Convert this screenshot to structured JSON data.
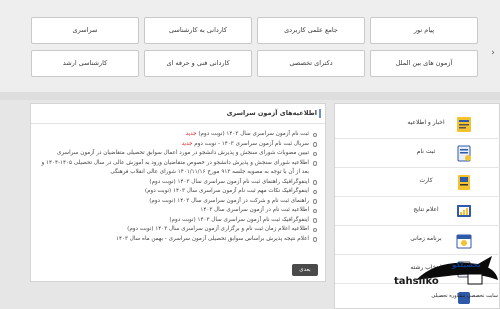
{
  "nav": {
    "row1": [
      "پیام نور",
      "جامع علمی کاربردی",
      "کاردانی به کارشناسی",
      "سراسری"
    ],
    "row2": [
      "آزمون های بین الملل",
      "دکترای تخصصی",
      "کاردانی فنی و حرفه ای",
      "کارشناسی ارشد"
    ],
    "pager": "›"
  },
  "news": {
    "title": "اطلاعیه‌های آزمون سراسری",
    "items": [
      {
        "text": "ثبت نام آزمون سراسری سال ۱۴۰۳ (نوبت دوم)",
        "tag": "جدید"
      },
      {
        "text": "سریال ثبت نام آزمون سراسری ۱۴۰۳ - نوبت دوم",
        "tag": "جدید"
      },
      {
        "text": "تبیین مصوبات شورای سنجش و پذیرش دانشجو در مورد اعمال سوابق تحصیلی متقاضیان در آزمون سراسری",
        "tag": ""
      },
      {
        "text": "اطلاعیه شورای سنجش و پذیرش دانشجو در خصوص متقاضیان ورود به آموزش عالی در سال تحصیلی ۱۴۰۵-۱۴۰۴ و بعد از آن با توجه به مصوبه جلسه ۹۱۳ مورخ ۱۴۰۱/۱۱/۱۶ شورای عالی انقلاب فرهنگی",
        "tag": "",
        "two": true
      },
      {
        "text": "اینفوگرافیک راهنمای ثبت نام آزمون سراسری سال ۱۴۰۳ (نوبت دوم)",
        "tag": ""
      },
      {
        "text": "اینفوگرافیک نکات مهم ثبت نام آزمون سراسری سال ۱۴۰۳ (نوبت دوم)",
        "tag": ""
      },
      {
        "text": "راهنمای ثبت نام و شرکت در آزمون سراسری سال ۱۴۰۳ (نوبت دوم)",
        "tag": ""
      },
      {
        "text": "اطلاعیه ثبت نام در آزمون سراسری سال ۱۴۰۳",
        "tag": ""
      },
      {
        "text": "اینفوگرافیک ثبت نام آزمون سراسری سال ۱۴۰۳ (نوبت دوم)",
        "tag": ""
      },
      {
        "text": "اطلاعیه اعلام زمان ثبت نام و برگزاری آزمون سراسری سال ۱۴۰۳ (نوبت دوم)",
        "tag": ""
      },
      {
        "text": "اعلام نتیجه پذیرش براساس سوابق تحصیلی آزمون سراسری - بهمن ماه سال ۱۴۰۳",
        "tag": ""
      }
    ],
    "more": "بعدی"
  },
  "sidebar": {
    "items": [
      {
        "label": "اخبار و اطلاعیه",
        "icon": "news-icon"
      },
      {
        "label": "ثبت نام",
        "icon": "form-icon"
      },
      {
        "label": "کارت",
        "icon": "card-icon"
      },
      {
        "label": "اعلام نتایج",
        "icon": "results-icon"
      },
      {
        "label": "برنامه زمانی",
        "icon": "calendar-icon"
      },
      {
        "label": "انتخاب رشته",
        "icon": "choice-icon"
      },
      {
        "label": "",
        "icon": "misc-icon"
      }
    ]
  },
  "watermark": {
    "persian": "تحصیلکو",
    "latin": "tahsilko",
    "tagline": "سایت تخصصی مشاوره تحصیلی"
  },
  "colors": {
    "accent": "#6b8fc7",
    "new_tag": "#d22222",
    "watermark_blue": "#0a3d91"
  }
}
